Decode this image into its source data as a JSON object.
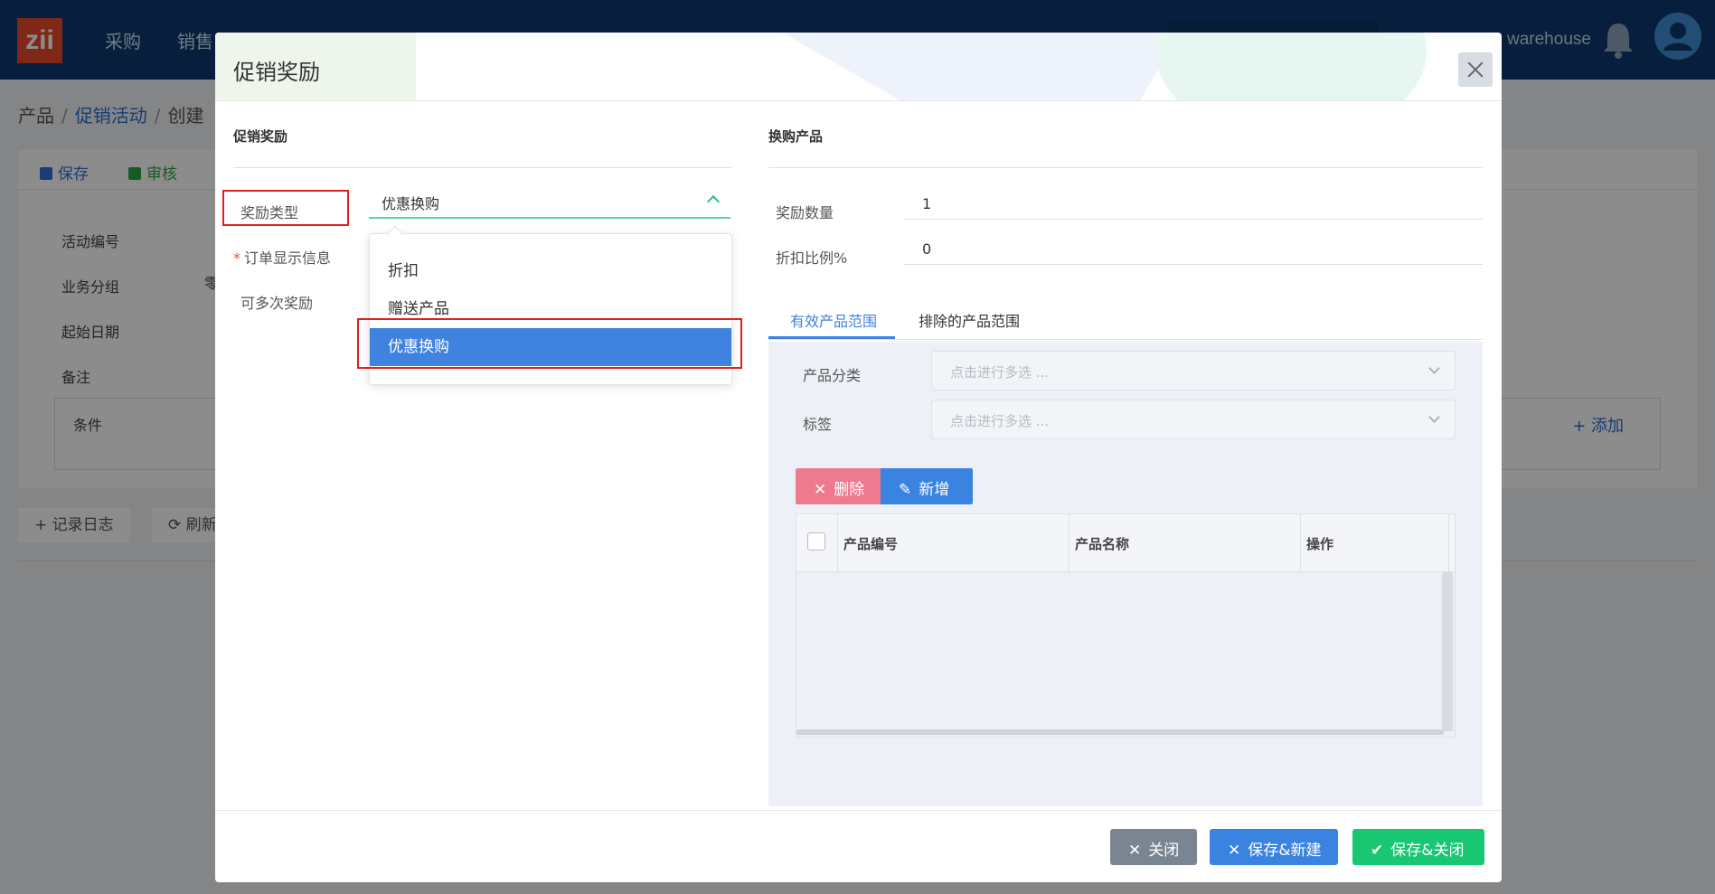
{
  "app": {
    "logo_text": "zii",
    "nav": [
      "采购",
      "销售"
    ],
    "user_label": "warehouse"
  },
  "breadcrumb": [
    "产品",
    "促销活动",
    "创建"
  ],
  "toolbar": {
    "save": "保存",
    "audit": "审核"
  },
  "background_form": {
    "labels": [
      "活动编号",
      "业务分组",
      "起始日期",
      "备注"
    ],
    "group_value_partial": "零",
    "condition_label": "条件",
    "add_label": "添加"
  },
  "log_bar": {
    "log": "记录日志",
    "refresh": "刷新"
  },
  "modal": {
    "title": "促销奖励",
    "left_section_title": "促销奖励",
    "right_section_title": "换购产品",
    "reward_type_label": "奖励类型",
    "reward_type_value": "优惠换购",
    "order_display_label": "订单显示信息",
    "multiple_reward_label": "可多次奖励",
    "dropdown_options": [
      "折扣",
      "赠送产品",
      "优惠换购"
    ],
    "selected_option_index": 2,
    "reward_qty_label": "奖励数量",
    "reward_qty_value": "1",
    "discount_pct_label": "折扣比例%",
    "discount_pct_value": "0",
    "tabs": [
      "有效产品范围",
      "排除的产品范围"
    ],
    "active_tab_index": 0,
    "category_label": "产品分类",
    "category_placeholder": "点击进行多选 ...",
    "tag_label": "标签",
    "tag_placeholder": "点击进行多选 ...",
    "delete_label": "删除",
    "add_new_label": "新增",
    "table_columns": [
      "产品编号",
      "产品名称",
      "操作"
    ],
    "footer": {
      "close": "关闭",
      "save_new": "保存&新建",
      "save_close": "保存&关闭"
    }
  },
  "colors": {
    "accent_blue": "#3a83e0",
    "success_green": "#19c773",
    "danger_pink": "#ee7a8f",
    "highlight_red": "#e02020",
    "topbar_navy": "#0d3a6e"
  }
}
